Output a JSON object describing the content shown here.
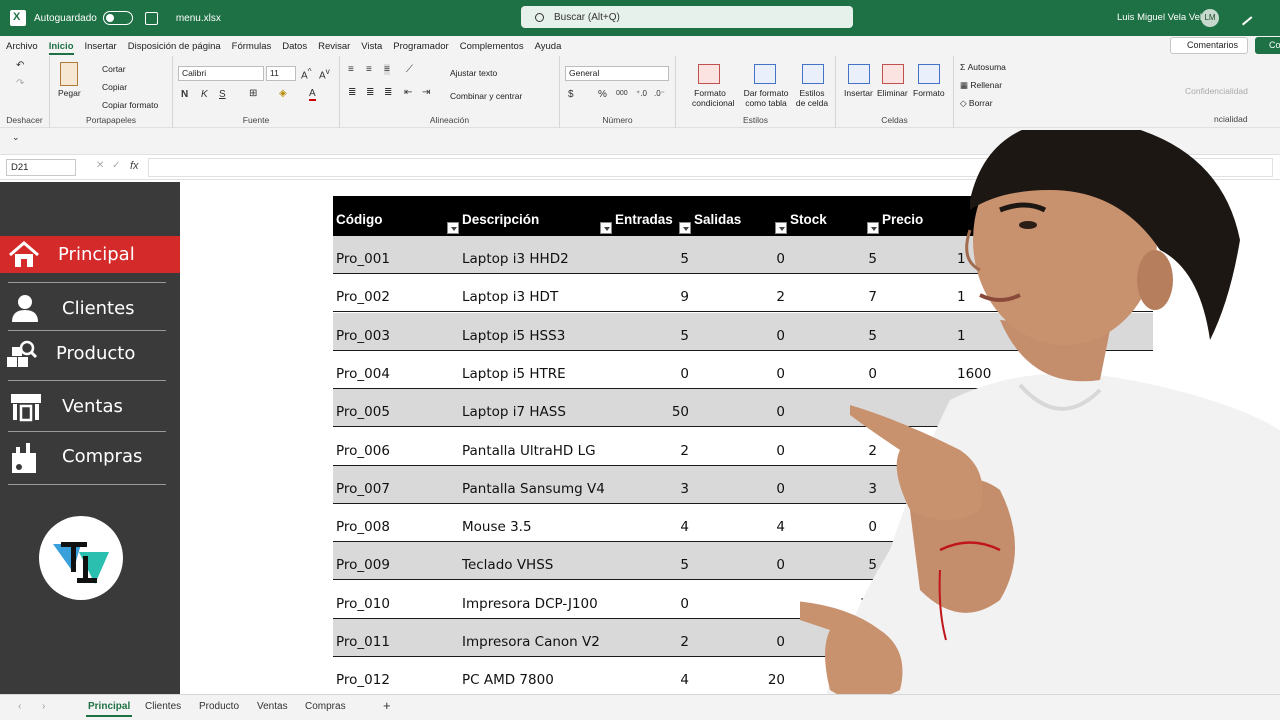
{
  "titlebar": {
    "autosave_label": "Autoguardado",
    "filename": "menu.xlsx",
    "search_placeholder": "Buscar (Alt+Q)",
    "user_name": "Luis Miguel Vela Vela",
    "user_initials": "LM"
  },
  "menu": {
    "tabs": [
      "Archivo",
      "Inicio",
      "Insertar",
      "Disposición de página",
      "Fórmulas",
      "Datos",
      "Revisar",
      "Vista",
      "Programador",
      "Complementos",
      "Ayuda"
    ],
    "active_tab": "Inicio",
    "comments_label": "Comentarios",
    "share_label": "Co"
  },
  "ribbon": {
    "undo_group": "Deshacer",
    "clipboard": {
      "paste": "Pegar",
      "cut": "Cortar",
      "copy": "Copiar",
      "format_painter": "Copiar formato",
      "label": "Portapapeles"
    },
    "font": {
      "name": "Calibri",
      "size": "11",
      "bold": "N",
      "italic": "K",
      "underline": "S",
      "label": "Fuente"
    },
    "alignment": {
      "wrap": "Ajustar texto",
      "merge": "Combinar y centrar",
      "label": "Alineación"
    },
    "number": {
      "format": "General",
      "label": "Número"
    },
    "styles": {
      "cond": "Formato condicional",
      "table": "Dar formato como tabla",
      "cell": "Estilos de celda",
      "label": "Estilos"
    },
    "cells": {
      "insert": "Insertar",
      "delete": "Eliminar",
      "format": "Formato",
      "label": "Celdas"
    },
    "editing": {
      "autosum": "Autosuma",
      "fill": "Rellenar",
      "clear": "Borrar"
    },
    "sensitivity": {
      "label": "Confidencialidad",
      "group": "ncialidad"
    }
  },
  "formula": {
    "cell_ref": "D21",
    "fx": "fx"
  },
  "sidebar": {
    "items": [
      {
        "label": "Principal",
        "icon": "home-icon"
      },
      {
        "label": "Clientes",
        "icon": "user-icon"
      },
      {
        "label": "Producto",
        "icon": "product-search-icon"
      },
      {
        "label": "Ventas",
        "icon": "store-icon"
      },
      {
        "label": "Compras",
        "icon": "shopping-bag-icon"
      }
    ],
    "active": "Principal"
  },
  "table": {
    "headers": [
      "Código",
      "Descripción",
      "Entradas",
      "Salidas",
      "Stock",
      "Precio"
    ],
    "rows": [
      {
        "code": "Pro_001",
        "desc": "Laptop i3 HHD2",
        "in": "5",
        "out": "0",
        "stock": "5",
        "price": "1"
      },
      {
        "code": "Pro_002",
        "desc": "Laptop i3 HDT",
        "in": "9",
        "out": "2",
        "stock": "7",
        "price": "1"
      },
      {
        "code": "Pro_003",
        "desc": "Laptop i5 HSS3",
        "in": "5",
        "out": "0",
        "stock": "5",
        "price": "1"
      },
      {
        "code": "Pro_004",
        "desc": "Laptop i5 HTRE",
        "in": "0",
        "out": "0",
        "stock": "0",
        "price": "1600"
      },
      {
        "code": "Pro_005",
        "desc": "Laptop i7 HASS",
        "in": "50",
        "out": "0",
        "stock": "",
        "price": ""
      },
      {
        "code": "Pro_006",
        "desc": "Pantalla UltraHD LG",
        "in": "2",
        "out": "0",
        "stock": "2",
        "price": ""
      },
      {
        "code": "Pro_007",
        "desc": "Pantalla Sansumg V4",
        "in": "3",
        "out": "0",
        "stock": "3",
        "price": ""
      },
      {
        "code": "Pro_008",
        "desc": "Mouse 3.5",
        "in": "4",
        "out": "4",
        "stock": "0",
        "price": ""
      },
      {
        "code": "Pro_009",
        "desc": "Teclado VHSS",
        "in": "5",
        "out": "0",
        "stock": "5",
        "price": ""
      },
      {
        "code": "Pro_010",
        "desc": "Impresora DCP-J100",
        "in": "0",
        "out": "",
        "stock": "10",
        "price": ""
      },
      {
        "code": "Pro_011",
        "desc": "Impresora Canon V2",
        "in": "2",
        "out": "0",
        "stock": "",
        "price": ""
      },
      {
        "code": "Pro_012",
        "desc": "PC AMD 7800",
        "in": "4",
        "out": "20",
        "stock": "",
        "price": ""
      }
    ]
  },
  "sheet_tabs": [
    "Principal",
    "Clientes",
    "Producto",
    "Ventas",
    "Compras"
  ],
  "active_sheet": "Principal",
  "colors": {
    "excel_green": "#1e7145",
    "sidebar_bg": "#3a3a3a",
    "active_red": "#d42a2a",
    "header_black": "#000000",
    "row_gray": "#d9d9d9"
  }
}
